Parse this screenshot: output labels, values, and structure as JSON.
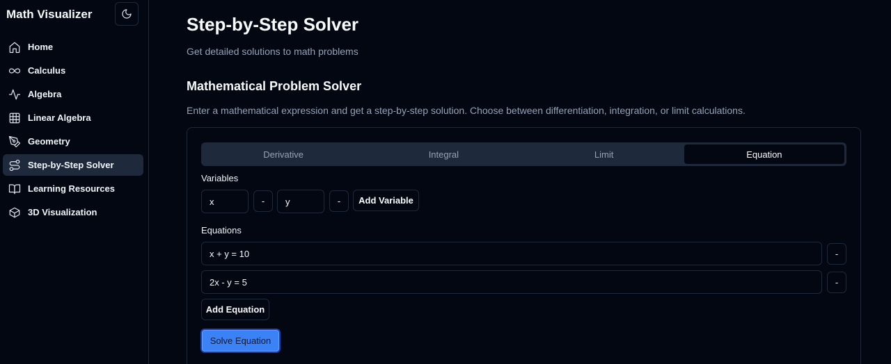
{
  "app": {
    "title": "Math Visualizer"
  },
  "sidebar": {
    "theme_toggle_icon": "moon-icon",
    "items": [
      {
        "label": "Home",
        "icon": "home-icon",
        "active": false
      },
      {
        "label": "Calculus",
        "icon": "infinity-icon",
        "active": false
      },
      {
        "label": "Algebra",
        "icon": "activity-icon",
        "active": false
      },
      {
        "label": "Linear Algebra",
        "icon": "grid-icon",
        "active": false
      },
      {
        "label": "Geometry",
        "icon": "pen-tool-icon",
        "active": false
      },
      {
        "label": "Step-by-Step Solver",
        "icon": "route-icon",
        "active": true
      },
      {
        "label": "Learning Resources",
        "icon": "book-icon",
        "active": false
      },
      {
        "label": "3D Visualization",
        "icon": "box-icon",
        "active": false
      }
    ]
  },
  "page": {
    "title": "Step-by-Step Solver",
    "subtitle": "Get detailed solutions to math problems"
  },
  "section": {
    "title": "Mathematical Problem Solver",
    "description": "Enter a mathematical expression and get a step-by-step solution. Choose between differentiation, integration, or limit calculations."
  },
  "tabs": [
    {
      "label": "Derivative",
      "active": false
    },
    {
      "label": "Integral",
      "active": false
    },
    {
      "label": "Limit",
      "active": false
    },
    {
      "label": "Equation",
      "active": true
    }
  ],
  "variables": {
    "label": "Variables",
    "values": [
      "x",
      "y"
    ],
    "remove_label": "-",
    "add_label": "Add Variable"
  },
  "equations": {
    "label": "Equations",
    "values": [
      "x + y = 10",
      "2x - y = 5"
    ],
    "remove_label": "-",
    "add_label": "Add Equation"
  },
  "solve": {
    "label": "Solve Equation"
  },
  "colors": {
    "background": "#030712",
    "border": "#1e293b",
    "muted_text": "#94a3b8",
    "primary": "#3b82f6"
  }
}
